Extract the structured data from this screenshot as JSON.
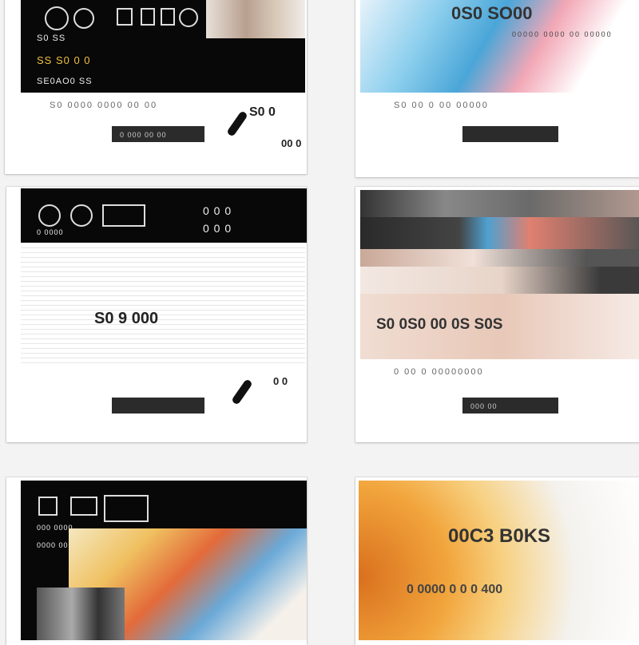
{
  "cards": [
    {
      "hero_caption": "S0 SS",
      "hero_small": "S0 SS",
      "hero_row": "SS S0 0 0",
      "hero_label": "SE0AO0 SS",
      "subtitle": "S0 0000 0000 00 00",
      "button_label": "0 000 00 00",
      "side_text": "S0 0",
      "side_text_2": "00 0"
    },
    {
      "hero_title": "0S0 SO00",
      "hero_sub": "00000 0000  00 00000",
      "subtitle": "S0  00  0  00 00000",
      "button_label": ""
    },
    {
      "hero_caption": "0 0000",
      "hero_label_1": "0 0 0",
      "hero_label_2": "0 0 0",
      "big_text": "S0 9 000",
      "button_label": "",
      "side_text": "0 0"
    },
    {
      "big_text": "S0 0S0 00 0S S0S",
      "subtitle": "0 00 0  00000000",
      "button_label": "000 00"
    },
    {
      "hero_caption": "000 0000",
      "hero_label": "0000 00"
    },
    {
      "big_text": "00C3 B0KS",
      "big_text_2": "0 0000 0 0 0 400"
    }
  ],
  "colors": {
    "page_bg": "#f3f3f3",
    "card_bg": "#ffffff",
    "dark_hero": "#080808",
    "button_bg": "#2b2b2b",
    "accent_blue": "#4aa6d8",
    "accent_orange": "#e7923a"
  }
}
